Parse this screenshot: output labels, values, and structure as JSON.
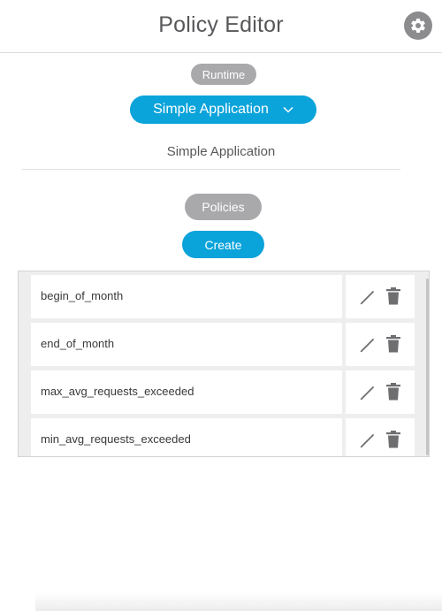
{
  "header": {
    "title": "Policy Editor",
    "settings_icon": "gear-icon"
  },
  "runtime": {
    "label": "Runtime"
  },
  "application": {
    "selected": "Simple Application",
    "name": "Simple Application",
    "dropdown_icon": "chevron-down-icon"
  },
  "policies": {
    "label": "Policies",
    "create_label": "Create",
    "items": [
      {
        "name": "begin_of_month"
      },
      {
        "name": "end_of_month"
      },
      {
        "name": "max_avg_requests_exceeded"
      },
      {
        "name": "min_avg_requests_exceeded"
      }
    ]
  },
  "colors": {
    "accent": "#0aa3da",
    "pill_gray": "#a9a9ab",
    "icon_gray": "#8c8c8f"
  }
}
